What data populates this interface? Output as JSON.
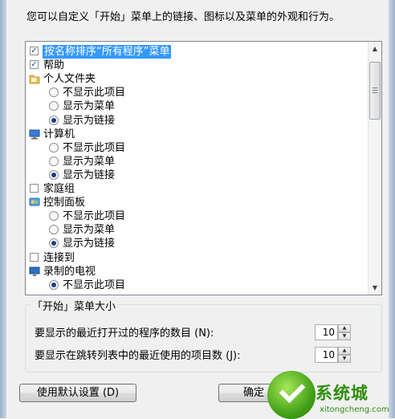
{
  "description": "您可以自定义「开始」菜单上的链接、图标以及菜单的外观和行为。",
  "list_items": [
    {
      "kind": "check",
      "label": "按名称排序“所有程序”菜单",
      "checked": true,
      "selected": true,
      "level": 0
    },
    {
      "kind": "check",
      "label": "帮助",
      "checked": true,
      "level": 0
    },
    {
      "kind": "folder",
      "label": "个人文件夹",
      "icon": "folder-icon",
      "level": 0
    },
    {
      "kind": "radio",
      "label": "不显示此项目",
      "checked": false,
      "level": 1
    },
    {
      "kind": "radio",
      "label": "显示为菜单",
      "checked": false,
      "level": 1
    },
    {
      "kind": "radio",
      "label": "显示为链接",
      "checked": true,
      "level": 1
    },
    {
      "kind": "folder",
      "label": "计算机",
      "icon": "computer-icon",
      "level": 0
    },
    {
      "kind": "radio",
      "label": "不显示此项目",
      "checked": false,
      "level": 1
    },
    {
      "kind": "radio",
      "label": "显示为菜单",
      "checked": false,
      "level": 1
    },
    {
      "kind": "radio",
      "label": "显示为链接",
      "checked": true,
      "level": 1
    },
    {
      "kind": "check",
      "label": "家庭组",
      "checked": false,
      "level": 0
    },
    {
      "kind": "folder",
      "label": "控制面板",
      "icon": "control-panel-icon",
      "level": 0
    },
    {
      "kind": "radio",
      "label": "不显示此项目",
      "checked": false,
      "level": 1
    },
    {
      "kind": "radio",
      "label": "显示为菜单",
      "checked": false,
      "level": 1
    },
    {
      "kind": "radio",
      "label": "显示为链接",
      "checked": true,
      "level": 1
    },
    {
      "kind": "check",
      "label": "连接到",
      "checked": false,
      "level": 0
    },
    {
      "kind": "folder",
      "label": "录制的电视",
      "icon": "tv-icon",
      "level": 0
    },
    {
      "kind": "radio",
      "label": "不显示此项目",
      "checked": true,
      "level": 1
    }
  ],
  "start_menu_size": {
    "title": "「开始」菜单大小",
    "recent_programs_label": "要显示的最近打开过的程序的数目 (N):",
    "recent_programs_value": "10",
    "jump_list_label": "要显示在跳转列表中的最近使用的项目数 (J):",
    "jump_list_value": "10"
  },
  "buttons": {
    "defaults": "使用默认设置 (D)",
    "ok": "确定"
  },
  "watermark": {
    "title": "系统城",
    "url": "xitongcheng.com"
  },
  "colors": {
    "selection": "#3399ff",
    "radio_dot": "#1a3e86",
    "watermark_green": "#2f8e0f"
  }
}
